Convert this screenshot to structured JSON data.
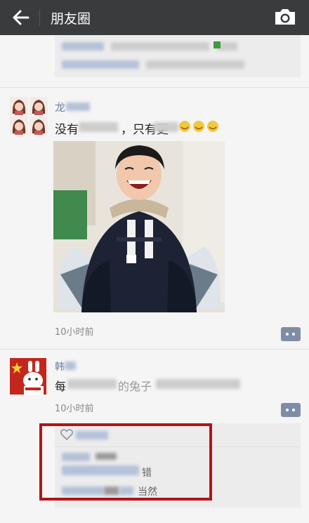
{
  "header": {
    "title": "朋友圈",
    "back_icon": "arrow-left-icon",
    "camera_icon": "camera-icon",
    "bg_color": "#3a3b3d"
  },
  "post1": {
    "author": "龙",
    "text_start": "没有",
    "text_mid": "，只有更",
    "time": "10小时前"
  },
  "post2": {
    "author": "韩",
    "text_start": "每",
    "text_mid": "的兔子",
    "time": "10小时前",
    "reply1_suffix": "错",
    "reply2_suffix": "当然"
  },
  "colors": {
    "link": "#6f7fa3",
    "highlight_frame": "#b3141b",
    "comment_button": "#7e8ca6"
  }
}
